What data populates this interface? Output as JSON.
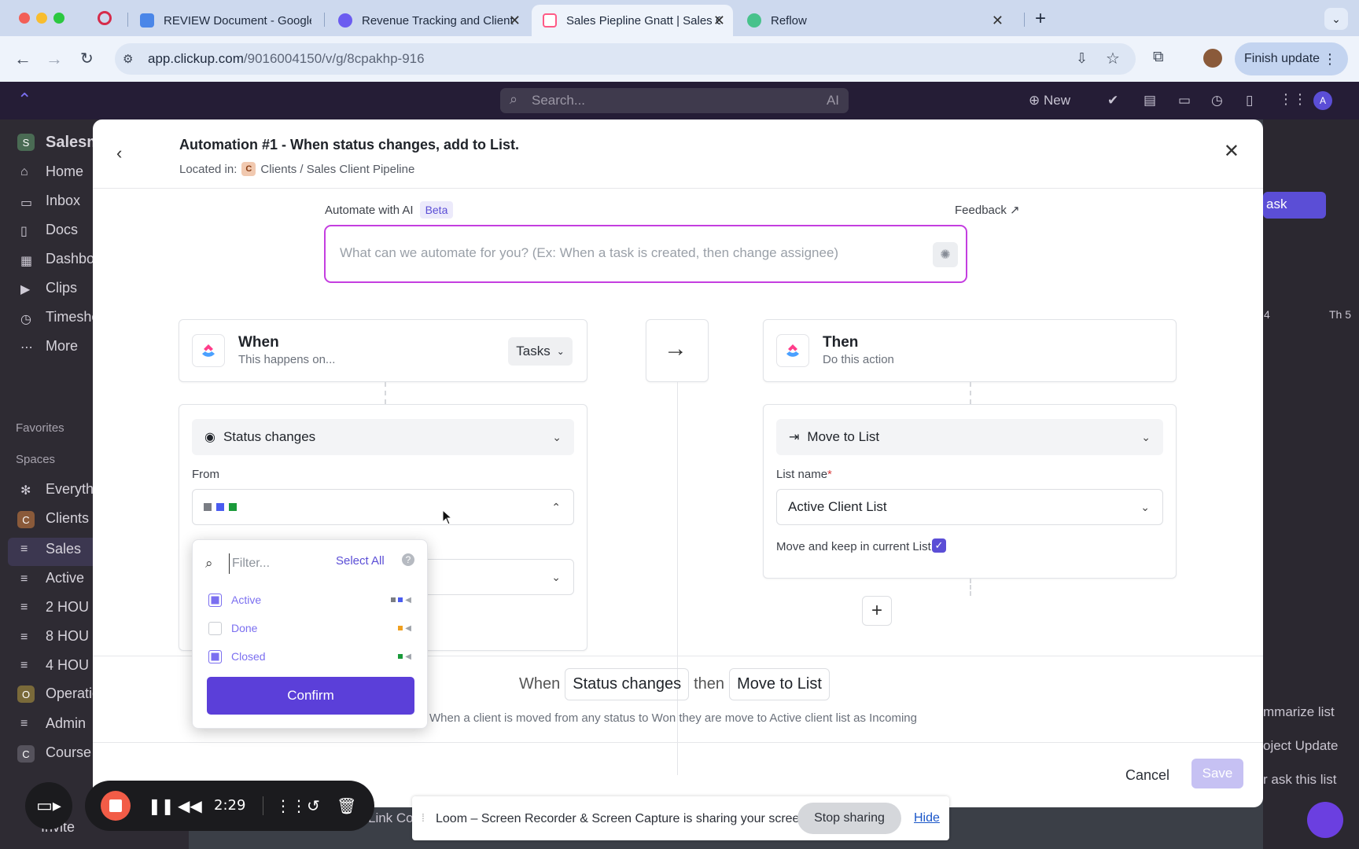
{
  "browser": {
    "tabs": [
      {
        "label": "REVIEW Document - Google Docs",
        "active": false
      },
      {
        "label": "Revenue Tracking and Client Management",
        "active": false
      },
      {
        "label": "Sales Piepline Gnatt | Sales Client Pipeline",
        "active": true
      },
      {
        "label": "Reflow",
        "active": false
      }
    ],
    "url_host": "app.clickup.com",
    "url_path": "/9016004150/v/g/8cpakhp-916",
    "finish_update": "Finish update"
  },
  "app": {
    "search_placeholder": "Search...",
    "ai_label": "AI",
    "new_label": "New",
    "workspace": "Salesm",
    "sidebar": {
      "items": [
        "Home",
        "Inbox",
        "Docs",
        "Dashbo",
        "Clips",
        "Timeshe",
        "More"
      ],
      "favorites": "Favorites",
      "spaces": "Spaces",
      "space_items": [
        "Everyth",
        "Clients",
        "Sales",
        "Active",
        "2 HOU",
        "8 HOU",
        "4 HOU",
        "Operatic",
        "Admin",
        "Course"
      ],
      "invite": "Invite",
      "link_co": "Link Co"
    },
    "right": {
      "task_btn": "ask",
      "day_4": "4",
      "day_th5": "Th 5",
      "summarize": "mmarize list",
      "project_update": "oject Update",
      "ask_list": "r ask this list"
    }
  },
  "modal": {
    "title": "Automation #1 - When status changes, add to List.",
    "located_in_label": "Located in:",
    "location_badge": "C",
    "location_path": "Clients / Sales Client Pipeline",
    "ai_label": "Automate with AI",
    "beta_badge": "Beta",
    "feedback": "Feedback",
    "ai_placeholder": "What can we automate for you? (Ex: When a task is created, then change assignee)",
    "when_card": {
      "title": "When",
      "subtitle": "This happens on...",
      "scope": "Tasks"
    },
    "then_card": {
      "title": "Then",
      "subtitle": "Do this action"
    },
    "trigger": {
      "selected": "Status changes",
      "from_label": "From",
      "from_colors": [
        "#7a7d84",
        "#4a5cf0",
        "#1a9a3a"
      ]
    },
    "action": {
      "selected": "Move to List",
      "list_name_label": "List name",
      "list_name_value": "Active Client List",
      "keep_label": "Move and keep in current List:",
      "keep_checked": true
    },
    "summary": {
      "when": "When",
      "trigger": "Status changes",
      "then": "then",
      "action": "Move to List"
    },
    "description": "When a client is moved from any status to Won they are move to Active client list as Incoming",
    "cancel": "Cancel",
    "save": "Save"
  },
  "filter_popup": {
    "placeholder": "Filter...",
    "select_all": "Select All",
    "help": "?",
    "options": [
      {
        "label": "Active",
        "checked": true,
        "colors": [
          "#7a7d84",
          "#4a5cf0"
        ]
      },
      {
        "label": "Done",
        "checked": false,
        "colors": [
          "#f0a020"
        ]
      },
      {
        "label": "Closed",
        "checked": true,
        "colors": [
          "#1a9a3a"
        ]
      }
    ],
    "confirm": "Confirm"
  },
  "loom": {
    "time": "2:29",
    "share_message": "Loom – Screen Recorder & Screen Capture is sharing your screen.",
    "stop_sharing": "Stop sharing",
    "hide": "Hide"
  }
}
